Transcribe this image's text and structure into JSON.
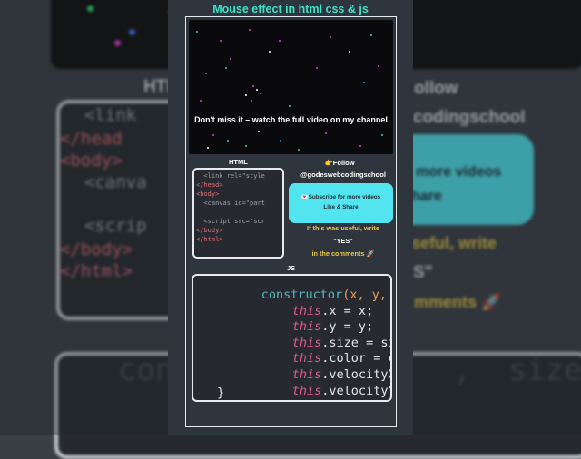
{
  "title": "Mouse effect in html css & js",
  "video": {
    "caption": "Don't miss it – watch the full video on my channel"
  },
  "sections": {
    "html_label": "HTML",
    "js_label": "JS"
  },
  "html_code": {
    "lines": [
      "  <link rel=\"style",
      "</head>",
      "<body>",
      "  <canvas id=\"part",
      "",
      "  <script src=\"scr",
      "</body>",
      "</html>"
    ]
  },
  "follow": {
    "label": "👉Follow",
    "handle": "@godeswebcodingschool",
    "button_line1": "💌Subscribe for more videos",
    "button_line2": "Like & Share",
    "useful_line": "If this was useful, write",
    "yes_line": "\"YES\"",
    "comments_line": "in the comments 🚀"
  },
  "js_code": {
    "line1_kw": "constructor",
    "line1_args": "(x, y, size",
    "prop_lines": [
      {
        "kw": "this",
        "rest": ".x = x;"
      },
      {
        "kw": "this",
        "rest": ".y = y;"
      },
      {
        "kw": "this",
        "rest": ".size = size;"
      },
      {
        "kw": "this",
        "rest": ".color = color"
      },
      {
        "kw": "this",
        "rest": ".velocityX = ve"
      },
      {
        "kw": "this",
        "rest": ".velocityY = ve"
      }
    ],
    "closing": "}"
  },
  "background": {
    "html_heading": "HTM",
    "follow_heading": "ollow",
    "handle_fragment": "codingschool",
    "code_lines": [
      "  <link",
      "</head",
      "<body>",
      "  <canva",
      "",
      "  <scrip",
      "</body>",
      "</html>"
    ],
    "cyan_line1": "more videos",
    "cyan_line2": "hare",
    "useful_fragment": "seful, write",
    "yes_fragment": "S\"",
    "comments_fragment": "mments 🚀",
    "js_fragment": "con               ,  size."
  },
  "colors": {
    "accent_title": "#3ee0c9",
    "subscribe_button": "#52e5f0",
    "highlight_yellow": "#e9c74a",
    "panel_bg": "#2f353c"
  }
}
